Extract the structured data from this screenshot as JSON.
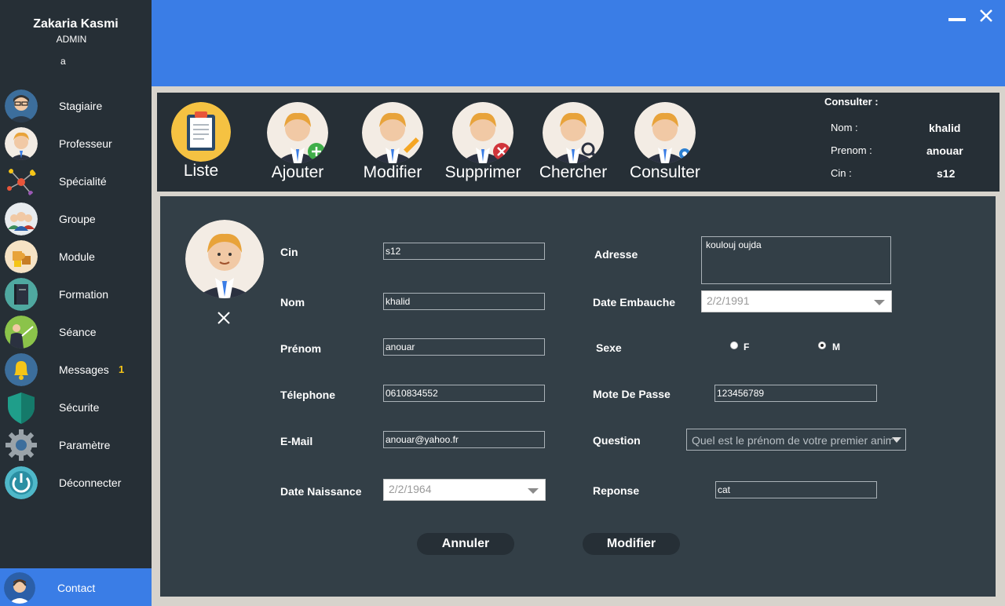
{
  "user": {
    "name": "Zakaria Kasmi",
    "role": "ADMIN",
    "extra": "a"
  },
  "sidebar": {
    "items": [
      {
        "label": "Stagiaire",
        "icon": "student-icon"
      },
      {
        "label": "Professeur",
        "icon": "teacher-icon"
      },
      {
        "label": "Spécialité",
        "icon": "network-icon"
      },
      {
        "label": "Groupe",
        "icon": "group-icon"
      },
      {
        "label": "Module",
        "icon": "puzzle-icon"
      },
      {
        "label": "Formation",
        "icon": "book-icon"
      },
      {
        "label": "Séance",
        "icon": "presenter-icon"
      },
      {
        "label": "Messages",
        "icon": "bell-icon",
        "badge": "1"
      },
      {
        "label": "Sécurite",
        "icon": "shield-icon"
      },
      {
        "label": "Paramètre",
        "icon": "gear-icon"
      },
      {
        "label": "Déconnecter",
        "icon": "power-icon"
      }
    ],
    "contact": "Contact"
  },
  "toolbar": {
    "tools": [
      {
        "label": "Liste",
        "icon": "clipboard-icon"
      },
      {
        "label": "Ajouter",
        "icon": "add-user-icon"
      },
      {
        "label": "Modifier",
        "icon": "edit-user-icon"
      },
      {
        "label": "Supprimer",
        "icon": "delete-user-icon"
      },
      {
        "label": "Chercher",
        "icon": "search-user-icon"
      },
      {
        "label": "Consulter",
        "icon": "view-user-icon"
      }
    ],
    "consult": {
      "title": "Consulter :",
      "nom_label": "Nom :",
      "nom": "khalid",
      "prenom_label": "Prenom :",
      "prenom": "anouar",
      "cin_label": "Cin :",
      "cin": "s12"
    }
  },
  "form": {
    "cin_label": "Cin",
    "cin": "s12",
    "nom_label": "Nom",
    "nom": "khalid",
    "prenom_label": "Prénom",
    "prenom": "anouar",
    "telephone_label": "Télephone",
    "telephone": "0610834552",
    "email_label": "E-Mail",
    "email": "anouar@yahoo.fr",
    "naissance_label": "Date Naissance",
    "naissance": "2/2/1964",
    "adresse_label": "Adresse",
    "adresse": "koulouj oujda",
    "embauche_label": "Date Embauche",
    "embauche": "2/2/1991",
    "sexe_label": "Sexe",
    "sexe_f": "F",
    "sexe_m": "M",
    "sexe_selected": "M",
    "password_label": "Mote De Passe",
    "password": "123456789",
    "question_label": "Question",
    "question": "Quel est le prénom de votre premier anim",
    "reponse_label": "Reponse",
    "reponse": "cat",
    "cancel": "Annuler",
    "submit": "Modifier"
  },
  "colors": {
    "accent": "#3a7de6",
    "sidebar": "#262f36",
    "panel": "#333f47",
    "badge": "#f5c518"
  }
}
